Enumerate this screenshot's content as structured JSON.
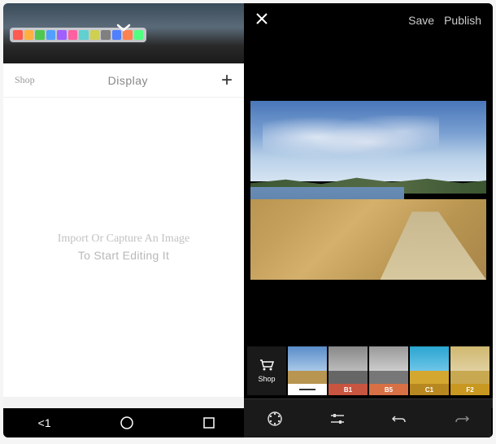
{
  "leftPanel": {
    "nav": {
      "shop": "Shop",
      "center": "Display",
      "plus": "+"
    },
    "empty": {
      "line1": "Import Or Capture An Image",
      "line2": "To Start Editing It"
    },
    "androidBack": "<1"
  },
  "rightPanel": {
    "top": {
      "save": "Save",
      "publish": "Publish"
    },
    "filters": {
      "shopLabel": "Shop",
      "items": [
        {
          "name": "original",
          "label": "—",
          "bg": "#fff",
          "sky": "#5a8cc8",
          "ground": "#b89550",
          "labelBg": "#fff",
          "selected": true
        },
        {
          "name": "b1",
          "label": "B1",
          "bg": "#c85540",
          "sky": "#888",
          "ground": "#666",
          "labelBg": "#c85540"
        },
        {
          "name": "b5",
          "label": "B5",
          "bg": "#d87045",
          "sky": "#999",
          "ground": "#777",
          "labelBg": "#d87045"
        },
        {
          "name": "c1",
          "label": "C1",
          "bg": "#d4a830",
          "sky": "#2aa5d0",
          "ground": "#d4a830",
          "labelBg": "#b88820"
        },
        {
          "name": "f2",
          "label": "F2",
          "bg": "#d4a830",
          "sky": "#d0b870",
          "ground": "#c8a850",
          "labelBg": "#c89820"
        }
      ]
    }
  },
  "colors": {
    "dockItems": [
      "#ff5a50",
      "#ffb040",
      "#50c850",
      "#50a0ff",
      "#a060ff",
      "#ff60a0",
      "#60d0d0",
      "#d0d050",
      "#808080",
      "#5080ff",
      "#ff8050",
      "#50ff80"
    ]
  }
}
